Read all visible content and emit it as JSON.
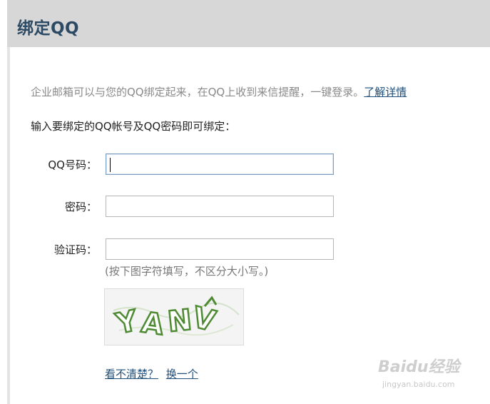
{
  "header": {
    "title": "绑定QQ"
  },
  "intro": {
    "text": "企业邮箱可以与您的QQ绑定起来，在QQ上收到来信提醒，一键登录。",
    "link_label": "了解详情"
  },
  "instruction": "输入要绑定的QQ帐号及QQ密码即可绑定：",
  "form": {
    "qq_label": "QQ号码：",
    "qq_value": "",
    "password_label": "密码：",
    "password_value": "",
    "captcha_label": "验证码：",
    "captcha_value": "",
    "captcha_hint": "(按下图字符填写，不区分大小写。)",
    "captcha_text": "YANV",
    "unclear_label": "看不清楚？",
    "refresh_label": "换一个"
  },
  "watermark": {
    "logo": "Baidu经验",
    "sub": "jingyan.baidu.com"
  },
  "colors": {
    "header_bg": "#d7d7d7",
    "title": "#2c4a64",
    "link": "#1f4f7a",
    "captcha_green": "#5a8a3a"
  }
}
